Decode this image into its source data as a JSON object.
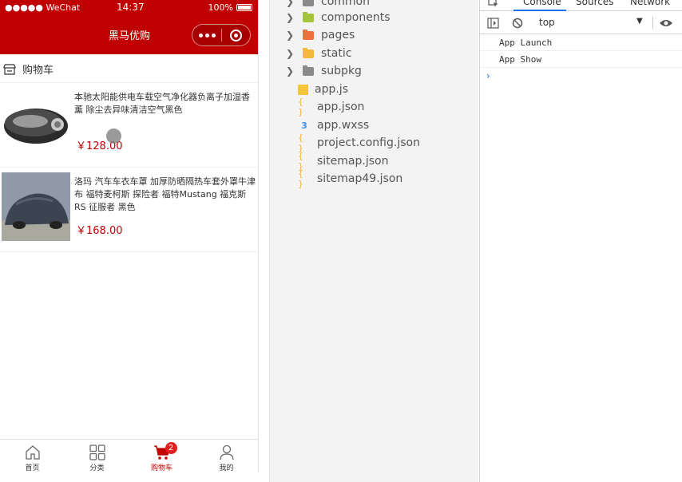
{
  "phone": {
    "status": {
      "carrier": "●●●●● WeChat",
      "time": "14:37",
      "battery": "100%"
    },
    "nav_title": "黑马优购",
    "cart_header": "购物车",
    "goods": [
      {
        "name": "本驰太阳能供电车载空气净化器负离子加湿香薰 除尘去异味清洁空气黑色",
        "price": "￥128.00"
      },
      {
        "name": "洛玛 汽车车衣车罩 加厚防晒隔热车套外罩牛津布 福特麦柯斯 探险者 福特Mustang 福克斯RS 征服者 黑色",
        "price": "￥168.00"
      }
    ],
    "tabs": [
      {
        "label": "首页",
        "icon": "home-icon"
      },
      {
        "label": "分类",
        "icon": "category-icon"
      },
      {
        "label": "购物车",
        "icon": "cart-icon",
        "badge": "2"
      },
      {
        "label": "我的",
        "icon": "user-icon"
      }
    ],
    "accent": "#c00000"
  },
  "explorer": {
    "items": [
      {
        "label": "common",
        "kind": "folder",
        "color": "#8a8a8a"
      },
      {
        "label": "components",
        "kind": "folder",
        "color": "#a4c53b"
      },
      {
        "label": "pages",
        "kind": "folder",
        "color": "#f0703c"
      },
      {
        "label": "static",
        "kind": "folder",
        "color": "#f3b83c"
      },
      {
        "label": "subpkg",
        "kind": "folder",
        "color": "#8a8a8a"
      },
      {
        "label": "app.js",
        "kind": "js",
        "color": "#f3c53c"
      },
      {
        "label": "app.json",
        "kind": "json",
        "color": "#f3b83c"
      },
      {
        "label": "app.wxss",
        "kind": "css",
        "color": "#3c8df3"
      },
      {
        "label": "project.config.json",
        "kind": "json",
        "color": "#f3b83c"
      },
      {
        "label": "sitemap.json",
        "kind": "json",
        "color": "#f3b83c"
      },
      {
        "label": "sitemap49.json",
        "kind": "json",
        "color": "#f3b83c"
      }
    ]
  },
  "devtools": {
    "tabs": [
      "Console",
      "Sources",
      "Network"
    ],
    "active_tab": "Console",
    "context": "top",
    "logs": [
      "App  Launch",
      "App  Show"
    ],
    "prompt": "›"
  }
}
